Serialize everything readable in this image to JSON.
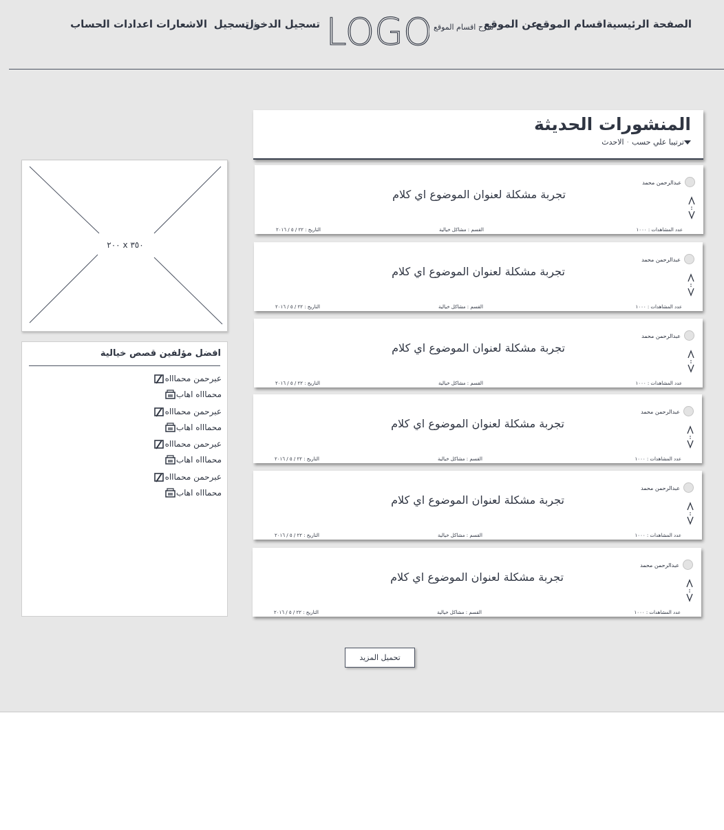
{
  "header": {
    "nav": {
      "home": "الصفحة الرئيسية",
      "sections": "اقسام الموقع",
      "about": "عن الموقع",
      "site_sections_guide": "شرح اقسام الموقع",
      "logo": "LOGO",
      "login": "تسجيل الدخول",
      "separator": "/",
      "register": "تسجيل",
      "notifications": "الاشعارات",
      "account_settings": "اعدادات الحساب"
    }
  },
  "posts_panel": {
    "title": "المنشورات الحديثة",
    "sort_label": "ترتيبا علي حسب",
    "sort_dot": "·",
    "sort_value": "الاحدث"
  },
  "posts": [
    {
      "author": "عبدالرحمن محمد",
      "title": "تجربة مشكلة لعنوان الموضوع اي كلام",
      "views": "عدد المشاهدات : ١٠٠٠",
      "category": "القسم : مشاكل خيالية",
      "date": "التاريخ : ٢٢ / ٥ / ٢٠١٦"
    },
    {
      "author": "عبدالرحمن محمد",
      "title": "تجربة مشكلة لعنوان الموضوع اي كلام",
      "views": "عدد المشاهدات : ١٠٠٠",
      "category": "القسم : مشاكل خيالية",
      "date": "التاريخ : ٢٢ / ٥ / ٢٠١٦"
    },
    {
      "author": "عبدالرحمن محمد",
      "title": "تجربة مشكلة لعنوان الموضوع اي كلام",
      "views": "عدد المشاهدات : ١٠٠٠",
      "category": "القسم : مشاكل خيالية",
      "date": "التاريخ : ٢٢ / ٥ / ٢٠١٦"
    },
    {
      "author": "عبدالرحمن محمد",
      "title": "تجربة مشكلة لعنوان الموضوع اي كلام",
      "views": "عدد المشاهدات : ١٠٠٠",
      "category": "القسم : مشاكل خيالية",
      "date": "التاريخ : ٢٢ / ٥ / ٢٠١٦"
    },
    {
      "author": "عبدالرحمن محمد",
      "title": "تجربة مشكلة لعنوان الموضوع اي كلام",
      "views": "عدد المشاهدات : ١٠٠٠",
      "category": "القسم : مشاكل خيالية",
      "date": "التاريخ : ٢٢ / ٥ / ٢٠١٦"
    },
    {
      "author": "عبدالرحمن محمد",
      "title": "تجربة مشكلة لعنوان الموضوع اي كلام",
      "views": "عدد المشاهدات : ١٠٠٠",
      "category": "القسم : مشاكل خيالية",
      "date": "التاريخ : ٢٢ / ٥ / ٢٠١٦"
    }
  ],
  "load_more": "تحميل المزيد",
  "sidebar": {
    "ad_label": "٢٠٠ x ٣٥٠",
    "authors_title": "افضل مؤلفين قصص خيالية",
    "authors": [
      {
        "name": "عبرحمن محماااه",
        "icon": "pen-icon"
      },
      {
        "name": "محماااه اهاب",
        "icon": "typewriter-icon"
      },
      {
        "name": "عبرحمن محماااه",
        "icon": "pen-icon"
      },
      {
        "name": "محماااه اهاب",
        "icon": "typewriter-icon"
      },
      {
        "name": "عبرحمن محماااه",
        "icon": "pen-icon"
      },
      {
        "name": "محماااه اهاب",
        "icon": "typewriter-icon"
      },
      {
        "name": "عبرحمن محماااه",
        "icon": "pen-icon"
      },
      {
        "name": "محماااه اهاب",
        "icon": "typewriter-icon"
      }
    ]
  },
  "colors": {
    "page_bg": "#e7e7e7",
    "text": "#2f3542",
    "panel_bg": "#ffffff"
  }
}
